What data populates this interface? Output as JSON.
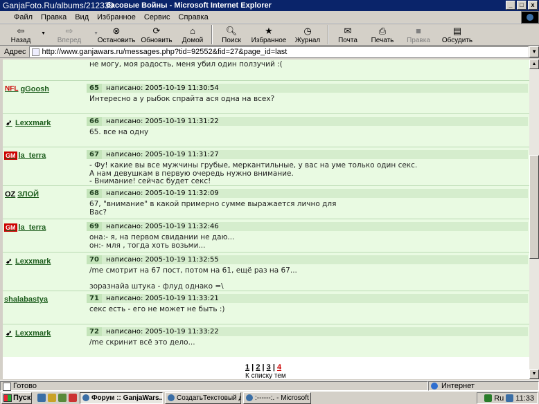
{
  "window": {
    "watermark": "GanjaFoto.Ru/albums/212339",
    "title": "басовые Войны - Microsoft Internet Explorer",
    "min": "_",
    "max": "□",
    "close": "x"
  },
  "menu": [
    "Файл",
    "Правка",
    "Вид",
    "Избранное",
    "Сервис",
    "Справка"
  ],
  "toolbar": {
    "back": "Назад",
    "forward": "Вперед",
    "stop": "Остановить",
    "refresh": "Обновить",
    "home": "Домой",
    "search": "Поиск",
    "favorites": "Избранное",
    "history": "Журнал",
    "mail": "Почта",
    "print": "Печать",
    "edit": "Правка",
    "discuss": "Обсудить"
  },
  "address": {
    "label": "Адрес",
    "url": "http://www.ganjawars.ru/messages.php?tid=92552&fid=27&page_id=last"
  },
  "posts": [
    {
      "user": "",
      "badge": "",
      "num": "",
      "date": "",
      "body": "не могу, моя радость, меня убил один ползучий :("
    },
    {
      "user": "gGoosh",
      "badge": "NFL",
      "num": "65",
      "date": "написано: 2005-10-19 11:30:54",
      "body": "Интересно а у рыбок спрайта ася одна на всех?"
    },
    {
      "user": "Lexxmark",
      "badge": "arrow",
      "num": "66",
      "date": "написано: 2005-10-19 11:31:22",
      "body": "65. все на одну"
    },
    {
      "user": "la_terra",
      "badge": "GM",
      "num": "67",
      "date": "написано: 2005-10-19 11:31:27",
      "body": "- Фу! какие вы все мужчины грубые, меркантильные, у вас на уме только один секс.\nА нам девушкам в первую очередь нужно внимание.\n- Внимание! сейчас будет секс!"
    },
    {
      "user": "ЗЛОЙ",
      "badge": "OZ",
      "num": "68",
      "date": "написано: 2005-10-19 11:32:09",
      "body": "67, \"внимание\" в какой примерно сумме выражается лично для\nВас?"
    },
    {
      "user": "la_terra",
      "badge": "GM",
      "num": "69",
      "date": "написано: 2005-10-19 11:32:46",
      "body": "она:- я, на первом свидании не даю...\nон:- мля , тогда хоть возьми..."
    },
    {
      "user": "Lexxmark",
      "badge": "arrow",
      "num": "70",
      "date": "написано: 2005-10-19 11:32:55",
      "body": "/me смотрит на 67 пост, потом на 61, ещё раз на 67...\n\nзоразнайа штука - флуд однако =\\"
    },
    {
      "user": "shalabastya",
      "badge": "",
      "num": "71",
      "date": "написано: 2005-10-19 11:33:21",
      "body": "секс есть - его не может не быть :)"
    },
    {
      "user": "Lexxmark",
      "badge": "arrow",
      "num": "72",
      "date": "написано: 2005-10-19 11:33:22",
      "body": "/me скринит всё это дело..."
    }
  ],
  "pager": {
    "p1": "1",
    "sep1": " | ",
    "p2": "2",
    "sep2": " | ",
    "p3": "3",
    "sep3": " | ",
    "p4": "4",
    "back": "К списку тем"
  },
  "status": {
    "left": "Готово",
    "zone": "Интернет"
  },
  "taskbar": {
    "start": "Пуск",
    "tasks": [
      "Форум :: GanjaWars....",
      "СоздатьТекстовый доку...",
      ":------:. - Microsoft Internet..."
    ],
    "lang": "Ru",
    "time": "11:33"
  },
  "colors": {
    "titlebar": "#0a246a",
    "forum_bg": "#e9fae2",
    "post_head": "#d5edcd",
    "username": "#1d5d1d",
    "current_page": "#cc0000"
  }
}
